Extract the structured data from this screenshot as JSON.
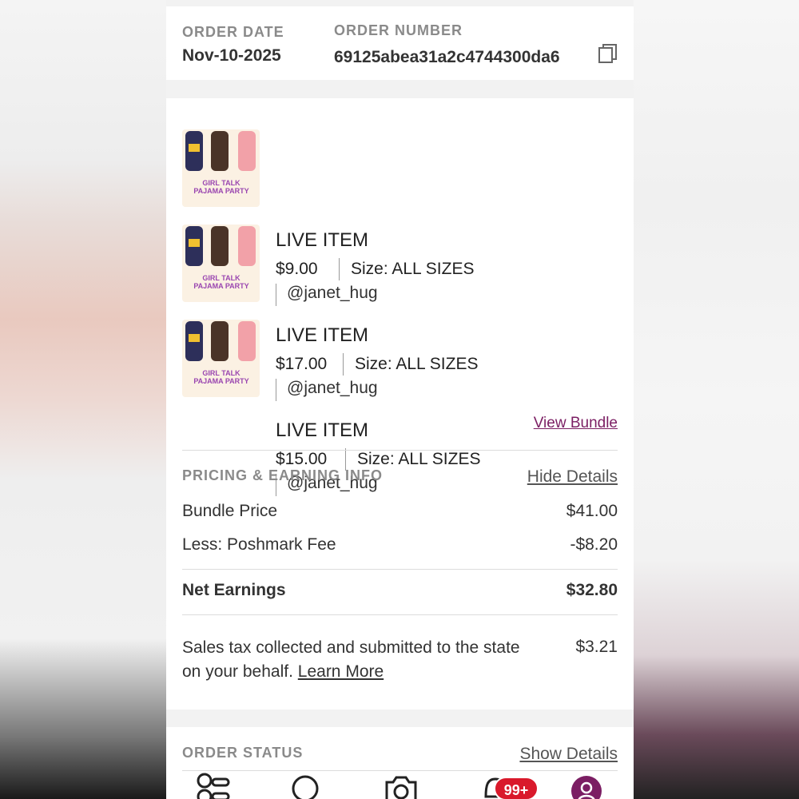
{
  "order": {
    "date_label": "ORDER DATE",
    "date_value": "Nov-10-2025",
    "number_label": "ORDER NUMBER",
    "number_value": "69125abea31a2c4744300da6"
  },
  "items": [
    {
      "title": "LIVE ITEM",
      "price": "$9.00",
      "size": "Size: ALL SIZES",
      "user": "@janet_hug",
      "thumb_text": "GIRL TALK PAJAMA PARTY"
    },
    {
      "title": "LIVE ITEM",
      "price": "$17.00",
      "size": "Size: ALL SIZES",
      "user": "@janet_hug",
      "thumb_text": "GIRL TALK PAJAMA PARTY"
    },
    {
      "title": "LIVE ITEM",
      "price": "$15.00",
      "size": "Size: ALL SIZES",
      "user": "@janet_hug",
      "thumb_text": "GIRL TALK PAJAMA PARTY"
    }
  ],
  "view_bundle": "View Bundle",
  "pricing": {
    "heading": "PRICING & EARNING INFO",
    "toggle": "Hide Details",
    "bundle_price_label": "Bundle Price",
    "bundle_price_value": "$41.00",
    "fee_label": "Less: Poshmark Fee",
    "fee_value": "-$8.20",
    "net_label": "Net Earnings",
    "net_value": "$32.80",
    "tax_text": "Sales tax collected and submitted to the state on your behalf.",
    "tax_link": "Learn More",
    "tax_value": "$3.21"
  },
  "status": {
    "heading": "ORDER STATUS",
    "toggle": "Show Details"
  },
  "nav": {
    "notifications_badge": "99+"
  },
  "colors": {
    "accent": "#7b1e63",
    "badge": "#d9192b",
    "thumb_bg": "#fbf1e3",
    "thumb_text": "#9a46b0"
  }
}
